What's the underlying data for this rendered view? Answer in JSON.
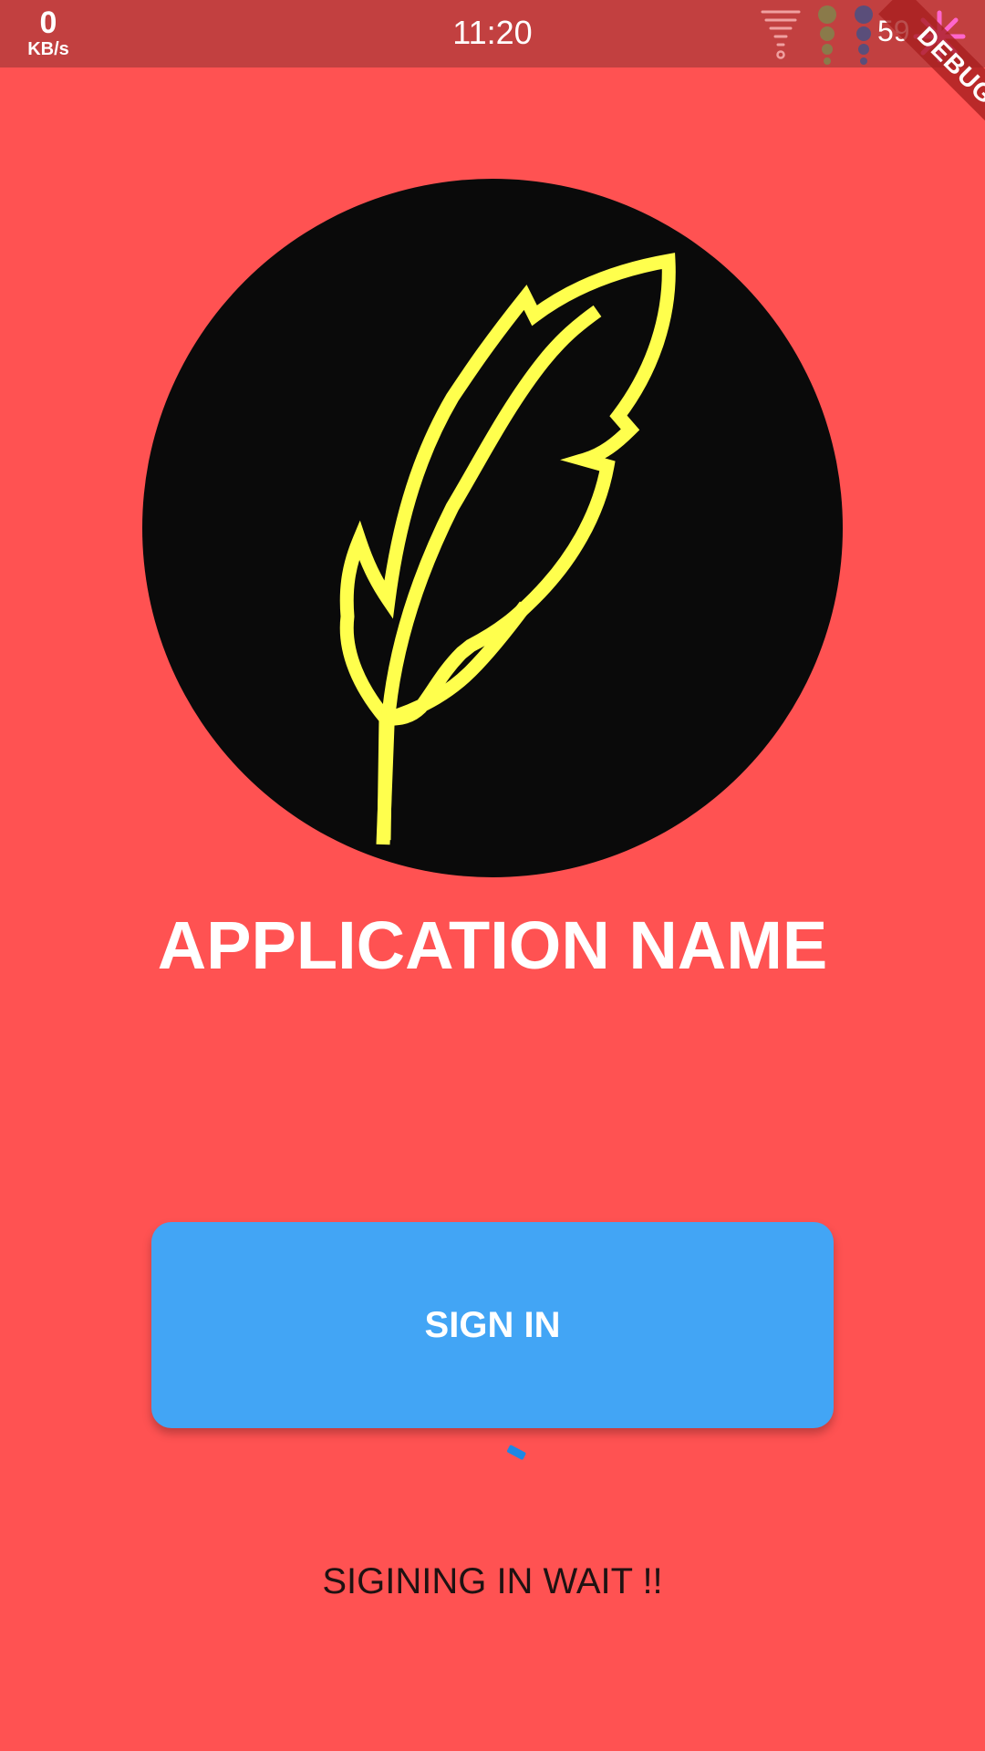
{
  "status_bar": {
    "net_speed_value": "0",
    "net_speed_unit": "KB/s",
    "time": "11:20",
    "battery": "59",
    "icons": [
      "wifi-icon",
      "signal-1-icon",
      "signal-2-icon",
      "loading-fan-icon"
    ]
  },
  "debug_banner": {
    "label": "DEBUG"
  },
  "logo": {
    "icon": "feather-icon"
  },
  "app": {
    "name": "APPLICATION NAME"
  },
  "signin": {
    "label": "SIGN IN"
  },
  "status": {
    "message": "SIGINING IN WAIT !!"
  },
  "colors": {
    "background": "#FF5252",
    "status_bar": "#C24040",
    "button": "#42A5F5",
    "feather": "#FFFF4D",
    "logo_circle": "#0A0A0A"
  }
}
